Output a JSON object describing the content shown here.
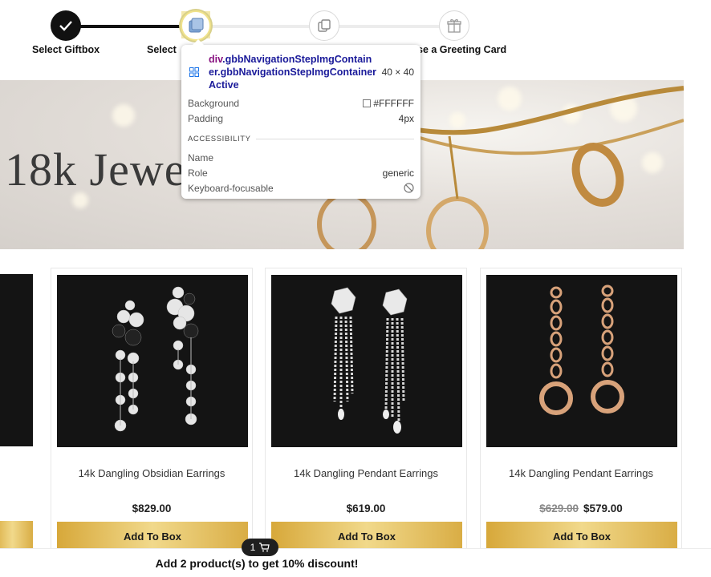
{
  "stepper": {
    "steps": [
      {
        "label": "Select Giftbox",
        "state": "done",
        "icon": "check-icon"
      },
      {
        "label": "Select",
        "state": "active",
        "icon": "box-icon"
      },
      {
        "label": "",
        "state": "todo",
        "icon": "copy-icon"
      },
      {
        "label": "se a Greeting Card",
        "state": "todo",
        "icon": "gift-icon"
      }
    ]
  },
  "banner": {
    "title": "18k Jewel"
  },
  "products": [
    {
      "name": "14k Dangling Obsidian Earrings",
      "price": "$829.00",
      "old_price": "",
      "button": "Add To Box"
    },
    {
      "name": "14k Dangling Pendant Earrings",
      "price": "$619.00",
      "old_price": "",
      "button": "Add To Box"
    },
    {
      "name": "14k Dangling Pendant Earrings",
      "price": "$579.00",
      "old_price": "$629.00",
      "button": "Add To Box"
    }
  ],
  "cart": {
    "count": "1",
    "message": "Add 2 product(s) to get 10% discount!"
  },
  "devtools_tooltip": {
    "tag": "div",
    "selector": ".gbbNavigationStepImgContainer.gbbNavigationStepImgContainerActive",
    "size": "40 × 40",
    "background_label": "Background",
    "background_value": "#FFFFFF",
    "padding_label": "Padding",
    "padding_value": "4px",
    "section": "ACCESSIBILITY",
    "name_label": "Name",
    "role_label": "Role",
    "role_value": "generic",
    "focusable_label": "Keyboard-focusable"
  },
  "colors": {
    "accent_gold": "#d7a83a",
    "dark": "#111111",
    "selector_blue": "#1a1a9a",
    "tag_purple": "#881280"
  }
}
